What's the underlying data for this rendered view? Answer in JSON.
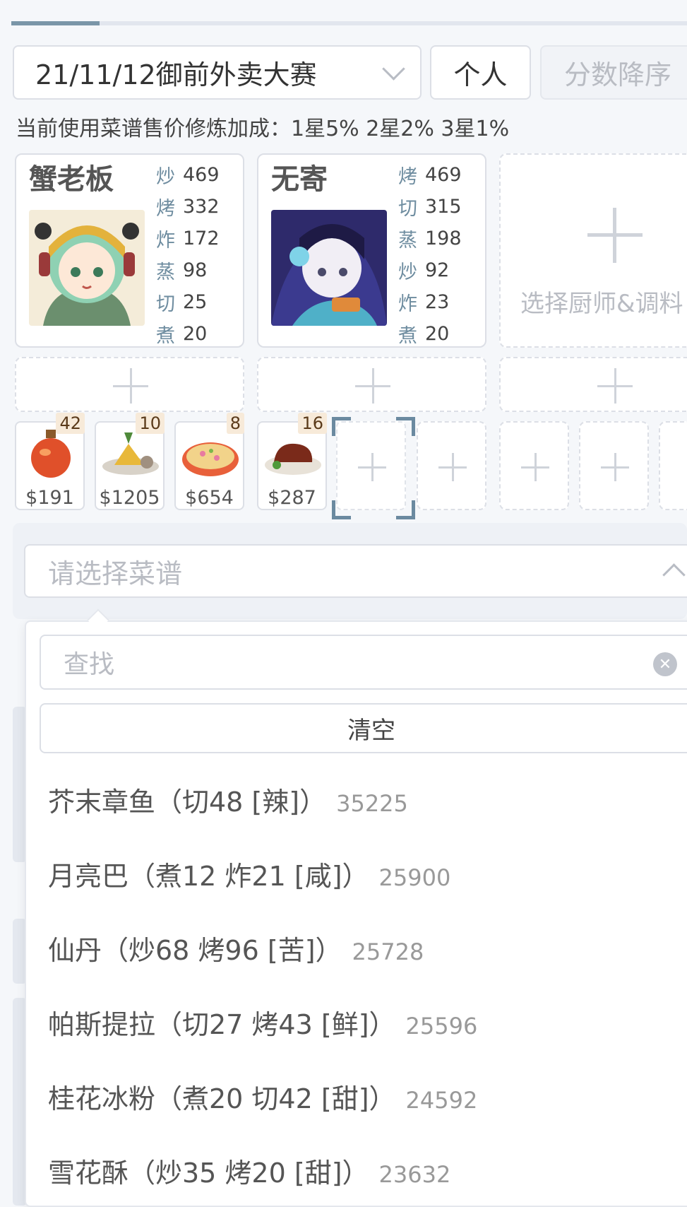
{
  "header": {
    "contest": "21/11/12御前外卖大赛",
    "mode": "个人",
    "sort": "分数降序",
    "bonus_text": "当前使用菜谱售价修炼加成：1星5% 2星2% 3星1%"
  },
  "chefs": [
    {
      "name": "蟹老板",
      "stats": [
        {
          "skill": "炒",
          "value": "469"
        },
        {
          "skill": "烤",
          "value": "332"
        },
        {
          "skill": "炸",
          "value": "172"
        },
        {
          "skill": "蒸",
          "value": "98"
        },
        {
          "skill": "切",
          "value": "25"
        },
        {
          "skill": "煮",
          "value": "20"
        }
      ]
    },
    {
      "name": "无寄",
      "stats": [
        {
          "skill": "烤",
          "value": "469"
        },
        {
          "skill": "切",
          "value": "315"
        },
        {
          "skill": "蒸",
          "value": "198"
        },
        {
          "skill": "炒",
          "value": "92"
        },
        {
          "skill": "炸",
          "value": "23"
        },
        {
          "skill": "煮",
          "value": "20"
        }
      ]
    }
  ],
  "empty_chef_label": "选择厨师&调料",
  "dishes": [
    {
      "qty": "42",
      "price": "$191"
    },
    {
      "qty": "10",
      "price": "$1205"
    },
    {
      "qty": "8",
      "price": "$654"
    },
    {
      "qty": "16",
      "price": "$287"
    }
  ],
  "recipe_select": {
    "placeholder": "请选择菜谱"
  },
  "dropdown": {
    "search_placeholder": "查找",
    "clear_label": "清空",
    "items": [
      {
        "label": "芥末章鱼（切48 [辣]）",
        "score": "35225"
      },
      {
        "label": "月亮巴（煮12 炸21 [咸]）",
        "score": "25900"
      },
      {
        "label": "仙丹（炒68 烤96 [苦]）",
        "score": "25728"
      },
      {
        "label": "帕斯提拉（切27 烤43 [鲜]）",
        "score": "25596"
      },
      {
        "label": "桂花冰粉（煮20 切42 [甜]）",
        "score": "24592"
      },
      {
        "label": "雪花酥（炒35 烤20 [甜]）",
        "score": "23632"
      }
    ]
  },
  "colors": {
    "accent": "#7a96a8",
    "skill": "#6f8da0",
    "qty_badge": "#f7ead9"
  }
}
